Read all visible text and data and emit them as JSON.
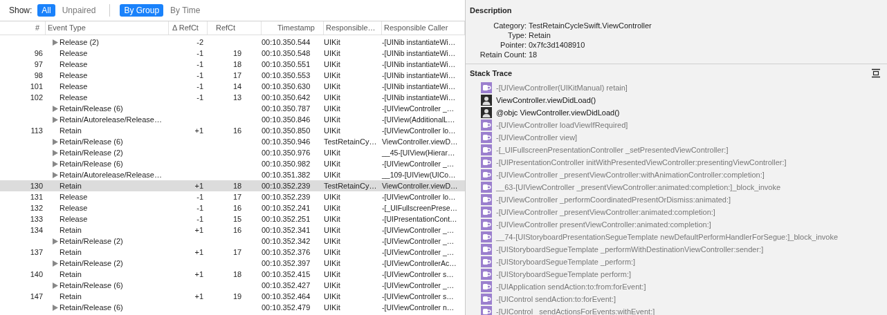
{
  "toolbar": {
    "label": "Show:",
    "filters": [
      {
        "label": "All",
        "selected": true
      },
      {
        "label": "Unpaired",
        "selected": false
      }
    ],
    "grouping": [
      {
        "label": "By Group",
        "selected": true
      },
      {
        "label": "By Time",
        "selected": false
      }
    ]
  },
  "table": {
    "columns": [
      "#",
      "Event Type",
      "Δ RefCt",
      "RefCt",
      "Timestamp",
      "Responsible…",
      "Responsible Caller"
    ],
    "rows": [
      {
        "kind": "group",
        "num": "",
        "type": "Release (2)",
        "delta": "-2",
        "refct": "",
        "time": "00:10.350.544",
        "library": "UIKit",
        "caller": "-[UINib instantiateWi…",
        "selected": false
      },
      {
        "kind": "event",
        "num": "96",
        "type": "Release",
        "delta": "-1",
        "refct": "19",
        "time": "00:10.350.548",
        "library": "UIKit",
        "caller": "-[UINib instantiateWi…",
        "selected": false
      },
      {
        "kind": "event",
        "num": "97",
        "type": "Release",
        "delta": "-1",
        "refct": "18",
        "time": "00:10.350.551",
        "library": "UIKit",
        "caller": "-[UINib instantiateWi…",
        "selected": false
      },
      {
        "kind": "event",
        "num": "98",
        "type": "Release",
        "delta": "-1",
        "refct": "17",
        "time": "00:10.350.553",
        "library": "UIKit",
        "caller": "-[UINib instantiateWi…",
        "selected": false
      },
      {
        "kind": "event",
        "num": "101",
        "type": "Release",
        "delta": "-1",
        "refct": "14",
        "time": "00:10.350.630",
        "library": "UIKit",
        "caller": "-[UINib instantiateWi…",
        "selected": false
      },
      {
        "kind": "event",
        "num": "102",
        "type": "Release",
        "delta": "-1",
        "refct": "13",
        "time": "00:10.350.642",
        "library": "UIKit",
        "caller": "-[UINib instantiateWi…",
        "selected": false
      },
      {
        "kind": "group",
        "num": "",
        "type": "Retain/Release (6)",
        "delta": "",
        "refct": "",
        "time": "00:10.350.787",
        "library": "UIKit",
        "caller": "-[UIViewController _…",
        "selected": false
      },
      {
        "kind": "group",
        "num": "",
        "type": "Retain/Autorelease/Release…",
        "delta": "",
        "refct": "",
        "time": "00:10.350.846",
        "library": "UIKit",
        "caller": "-[UIView(AdditionalL…",
        "selected": false
      },
      {
        "kind": "event",
        "num": "113",
        "type": "Retain",
        "delta": "+1",
        "refct": "16",
        "time": "00:10.350.850",
        "library": "UIKit",
        "caller": "-[UIViewController lo…",
        "selected": false
      },
      {
        "kind": "group",
        "num": "",
        "type": "Retain/Release (6)",
        "delta": "",
        "refct": "",
        "time": "00:10.350.946",
        "library": "TestRetainCy…",
        "caller": "ViewController.viewD…",
        "selected": false
      },
      {
        "kind": "group",
        "num": "",
        "type": "Retain/Release (2)",
        "delta": "",
        "refct": "",
        "time": "00:10.350.976",
        "library": "UIKit",
        "caller": "__45-[UIView(Hierar…",
        "selected": false
      },
      {
        "kind": "group",
        "num": "",
        "type": "Retain/Release (6)",
        "delta": "",
        "refct": "",
        "time": "00:10.350.982",
        "library": "UIKit",
        "caller": "-[UIViewController _…",
        "selected": false
      },
      {
        "kind": "group",
        "num": "",
        "type": "Retain/Autorelease/Release…",
        "delta": "",
        "refct": "",
        "time": "00:10.351.382",
        "library": "UIKit",
        "caller": "__109-[UIView(UICo…",
        "selected": false
      },
      {
        "kind": "event",
        "num": "130",
        "type": "Retain",
        "delta": "+1",
        "refct": "18",
        "time": "00:10.352.239",
        "library": "TestRetainCy…",
        "caller": "ViewController.viewD…",
        "selected": true
      },
      {
        "kind": "event",
        "num": "131",
        "type": "Release",
        "delta": "-1",
        "refct": "17",
        "time": "00:10.352.239",
        "library": "UIKit",
        "caller": "-[UIViewController lo…",
        "selected": false
      },
      {
        "kind": "event",
        "num": "132",
        "type": "Release",
        "delta": "-1",
        "refct": "16",
        "time": "00:10.352.241",
        "library": "UIKit",
        "caller": "-[_UIFullscreenPrese…",
        "selected": false
      },
      {
        "kind": "event",
        "num": "133",
        "type": "Release",
        "delta": "-1",
        "refct": "15",
        "time": "00:10.352.251",
        "library": "UIKit",
        "caller": "-[UIPresentationCont…",
        "selected": false
      },
      {
        "kind": "event",
        "num": "134",
        "type": "Retain",
        "delta": "+1",
        "refct": "16",
        "time": "00:10.352.341",
        "library": "UIKit",
        "caller": "-[UIViewController _…",
        "selected": false
      },
      {
        "kind": "group",
        "num": "",
        "type": "Retain/Release (2)",
        "delta": "",
        "refct": "",
        "time": "00:10.352.342",
        "library": "UIKit",
        "caller": "-[UIViewController _…",
        "selected": false
      },
      {
        "kind": "event",
        "num": "137",
        "type": "Retain",
        "delta": "+1",
        "refct": "17",
        "time": "00:10.352.376",
        "library": "UIKit",
        "caller": "-[UIViewController _…",
        "selected": false
      },
      {
        "kind": "group",
        "num": "",
        "type": "Retain/Release (2)",
        "delta": "",
        "refct": "",
        "time": "00:10.352.397",
        "library": "UIKit",
        "caller": "-[UIViewControllerAc…",
        "selected": false
      },
      {
        "kind": "event",
        "num": "140",
        "type": "Retain",
        "delta": "+1",
        "refct": "18",
        "time": "00:10.352.415",
        "library": "UIKit",
        "caller": "-[UIViewController s…",
        "selected": false
      },
      {
        "kind": "group",
        "num": "",
        "type": "Retain/Release (6)",
        "delta": "",
        "refct": "",
        "time": "00:10.352.427",
        "library": "UIKit",
        "caller": "-[UIViewController _…",
        "selected": false
      },
      {
        "kind": "event",
        "num": "147",
        "type": "Retain",
        "delta": "+1",
        "refct": "19",
        "time": "00:10.352.464",
        "library": "UIKit",
        "caller": "-[UIViewController s…",
        "selected": false
      },
      {
        "kind": "group",
        "num": "",
        "type": "Retain/Release (6)",
        "delta": "",
        "refct": "",
        "time": "00:10.352.479",
        "library": "UIKit",
        "caller": "-[UIViewController n…",
        "selected": false
      }
    ]
  },
  "description": {
    "title": "Description",
    "fields": [
      {
        "label": "Category:",
        "value": "TestRetainCycleSwift.ViewController"
      },
      {
        "label": "Type:",
        "value": "Retain"
      },
      {
        "label": "Pointer:",
        "value": "0x7fc3d1408910"
      },
      {
        "label": "Retain Count:",
        "value": "18"
      }
    ]
  },
  "stack_trace": {
    "title": "Stack Trace",
    "frames": [
      {
        "kind": "system",
        "text": "-[UIViewController(UIKitManual) retain]"
      },
      {
        "kind": "user",
        "text": "ViewController.viewDidLoad()"
      },
      {
        "kind": "user",
        "text": "@objc ViewController.viewDidLoad()"
      },
      {
        "kind": "system",
        "text": "-[UIViewController loadViewIfRequired]"
      },
      {
        "kind": "system",
        "text": "-[UIViewController view]"
      },
      {
        "kind": "system",
        "text": "-[_UIFullscreenPresentationController _setPresentedViewController:]"
      },
      {
        "kind": "system",
        "text": "-[UIPresentationController initWithPresentedViewController:presentingViewController:]"
      },
      {
        "kind": "system",
        "text": "-[UIViewController _presentViewController:withAnimationController:completion:]"
      },
      {
        "kind": "system",
        "text": "__63-[UIViewController _presentViewController:animated:completion:]_block_invoke"
      },
      {
        "kind": "system",
        "text": "-[UIViewController _performCoordinatedPresentOrDismiss:animated:]"
      },
      {
        "kind": "system",
        "text": "-[UIViewController _presentViewController:animated:completion:]"
      },
      {
        "kind": "system",
        "text": "-[UIViewController presentViewController:animated:completion:]"
      },
      {
        "kind": "system",
        "text": "__74-[UIStoryboardPresentationSegueTemplate newDefaultPerformHandlerForSegue:]_block_invoke"
      },
      {
        "kind": "system",
        "text": "-[UIStoryboardSegueTemplate _performWithDestinationViewController:sender:]"
      },
      {
        "kind": "system",
        "text": "-[UIStoryboardSegueTemplate _perform:]"
      },
      {
        "kind": "system",
        "text": "-[UIStoryboardSegueTemplate perform:]"
      },
      {
        "kind": "system",
        "text": "-[UIApplication sendAction:to:from:forEvent:]"
      },
      {
        "kind": "system",
        "text": "-[UIControl sendAction:to:forEvent:]"
      },
      {
        "kind": "system",
        "text": "-[UIControl _sendActionsForEvents:withEvent:]"
      }
    ]
  }
}
